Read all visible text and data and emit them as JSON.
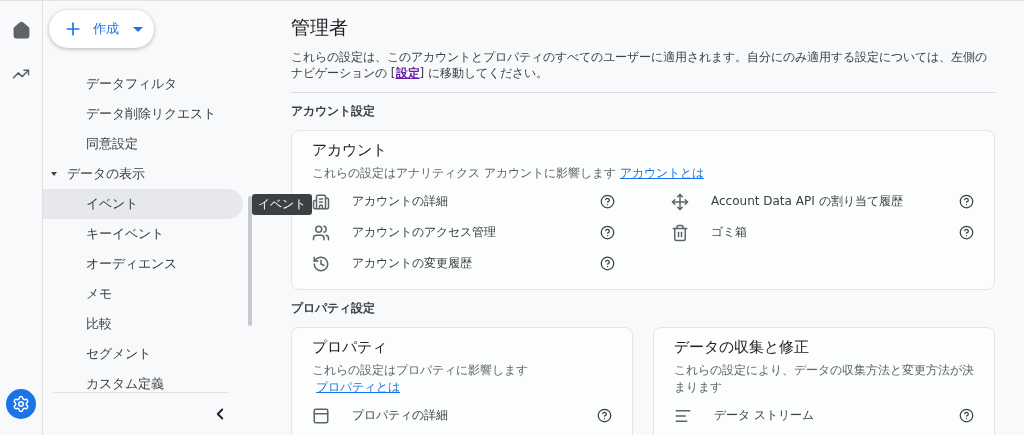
{
  "create_button": {
    "label": "作成"
  },
  "sidebar": {
    "items": [
      {
        "kind": "item",
        "label": "データフィルタ",
        "selected": false
      },
      {
        "kind": "item",
        "label": "データ削除リクエスト",
        "selected": false
      },
      {
        "kind": "item",
        "label": "同意設定",
        "selected": false
      },
      {
        "kind": "group",
        "label": "データの表示",
        "expanded": true,
        "children": [
          {
            "kind": "item",
            "label": "イベント",
            "selected": true
          },
          {
            "kind": "item",
            "label": "キーイベント",
            "selected": false
          },
          {
            "kind": "item",
            "label": "オーディエンス",
            "selected": false
          },
          {
            "kind": "item",
            "label": "メモ",
            "selected": false
          },
          {
            "kind": "item",
            "label": "比較",
            "selected": false
          },
          {
            "kind": "item",
            "label": "セグメント",
            "selected": false
          },
          {
            "kind": "item",
            "label": "カスタム定義",
            "selected": false
          }
        ]
      }
    ]
  },
  "tooltip": {
    "text": "イベント"
  },
  "main": {
    "title": "管理者",
    "description": {
      "before": "これらの設定は、このアカウントとプロパティのすべてのユーザーに適用されます。自分にのみ適用する設定については、左側のナビゲーションの [",
      "link": "設定",
      "after": "] に移動してください。"
    },
    "sections": [
      {
        "label": "アカウント設定",
        "cards": [
          {
            "title": "アカウント",
            "subtitle": "これらの設定はアナリティクス アカウントに影響します",
            "link": "アカウントとは",
            "columns": [
              [
                {
                  "kind": "building",
                  "label": "アカウントの詳細"
                },
                {
                  "kind": "people",
                  "label": "アカウントのアクセス管理"
                },
                {
                  "kind": "history",
                  "label": "アカウントの変更履歴"
                }
              ],
              [
                {
                  "kind": "api",
                  "label": "Account Data API の割り当て履歴"
                },
                {
                  "kind": "trash",
                  "label": "ゴミ箱"
                }
              ]
            ]
          }
        ]
      },
      {
        "label": "プロパティ設定",
        "cards": [
          {
            "title": "プロパティ",
            "subtitle": "これらの設定はプロパティに影響します",
            "link": "プロパティとは",
            "columns": [
              [
                {
                  "kind": "window",
                  "label": "プロパティの詳細"
                }
              ]
            ]
          },
          {
            "title": "データの収集と修正",
            "subtitle": "これらの設定により、データの収集方法と変更方法が決まります",
            "columns": [
              [
                {
                  "kind": "stream",
                  "label": "データ ストリーム"
                }
              ]
            ]
          }
        ]
      }
    ]
  }
}
